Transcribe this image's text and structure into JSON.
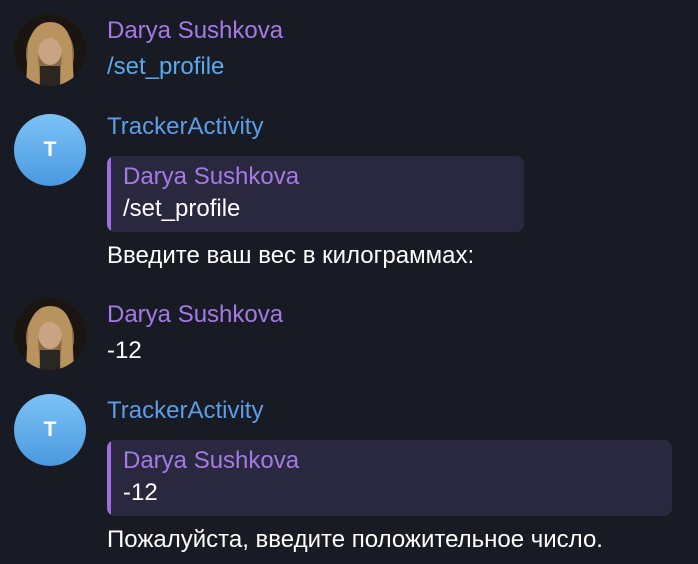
{
  "messages": [
    {
      "sender": "Darya Sushkova",
      "avatar": "user-photo",
      "text": "/set_profile"
    },
    {
      "sender": "TrackerActivity",
      "avatar_letter": "T",
      "reply": {
        "sender": "Darya Sushkova",
        "text": "/set_profile"
      },
      "text": "Введите ваш вес в килограммах:"
    },
    {
      "sender": "Darya Sushkova",
      "avatar": "user-photo",
      "text": "-12"
    },
    {
      "sender": "TrackerActivity",
      "avatar_letter": "T",
      "reply": {
        "sender": "Darya Sushkova",
        "text": "-12"
      },
      "text": "Пожалуйста, введите положительное число."
    }
  ],
  "colors": {
    "background": "#181b23",
    "user_name": "#a47ae6",
    "bot_name": "#5b9ee8",
    "command_link": "#5aa9f0",
    "reply_bg": "#29283f",
    "reply_bar": "#9b6fe6"
  }
}
